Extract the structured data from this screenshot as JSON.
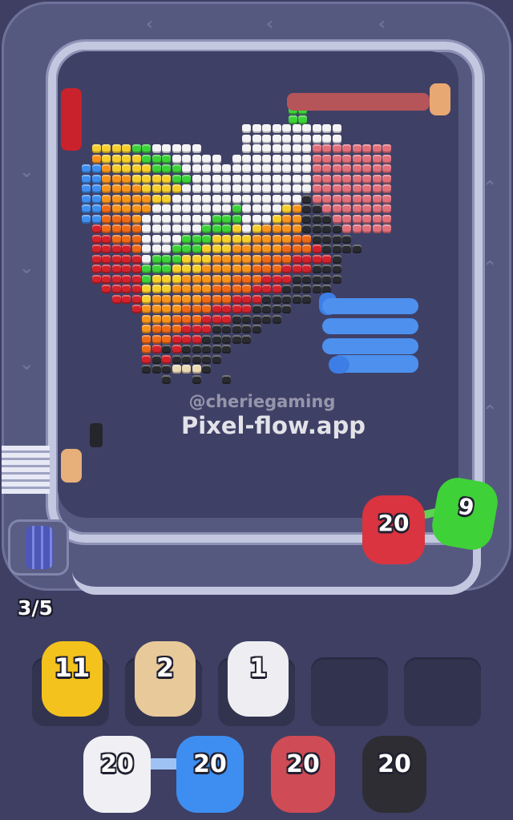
{
  "watermark": {
    "handle": "@cheriegaming",
    "site": "Pixel-flow.app"
  },
  "level_progress": "3/5",
  "conveyor_shooters": [
    {
      "id": "red",
      "count": "20",
      "color": "#d9343f"
    },
    {
      "id": "green",
      "count": "9",
      "color": "#3fd138"
    }
  ],
  "slots": [
    {
      "count": "11",
      "color": "#f4c21d",
      "filled": true
    },
    {
      "count": "2",
      "color": "#e8c99a",
      "filled": true
    },
    {
      "count": "1",
      "color": "#eeeef2",
      "filled": true
    },
    {
      "count": "",
      "filled": false
    },
    {
      "count": "",
      "filled": false
    }
  ],
  "queue": [
    {
      "count": "20",
      "color": "#f0f0f4"
    },
    {
      "count": "20",
      "color": "#3d8ef0"
    },
    {
      "count": "20",
      "color": "#cf4b55"
    },
    {
      "count": "20",
      "color": "#2d2d33"
    }
  ],
  "palette": {
    "white": "#f3f3f6",
    "green": "#3dd23a",
    "yellow": "#f6cf2d",
    "orange": "#f7941c",
    "deep_orange": "#ef6a17",
    "red": "#d3222b",
    "black": "#2a2b30",
    "pink": "#e2707b",
    "blue": "#3f8ff0",
    "cream": "#ead9b3"
  }
}
